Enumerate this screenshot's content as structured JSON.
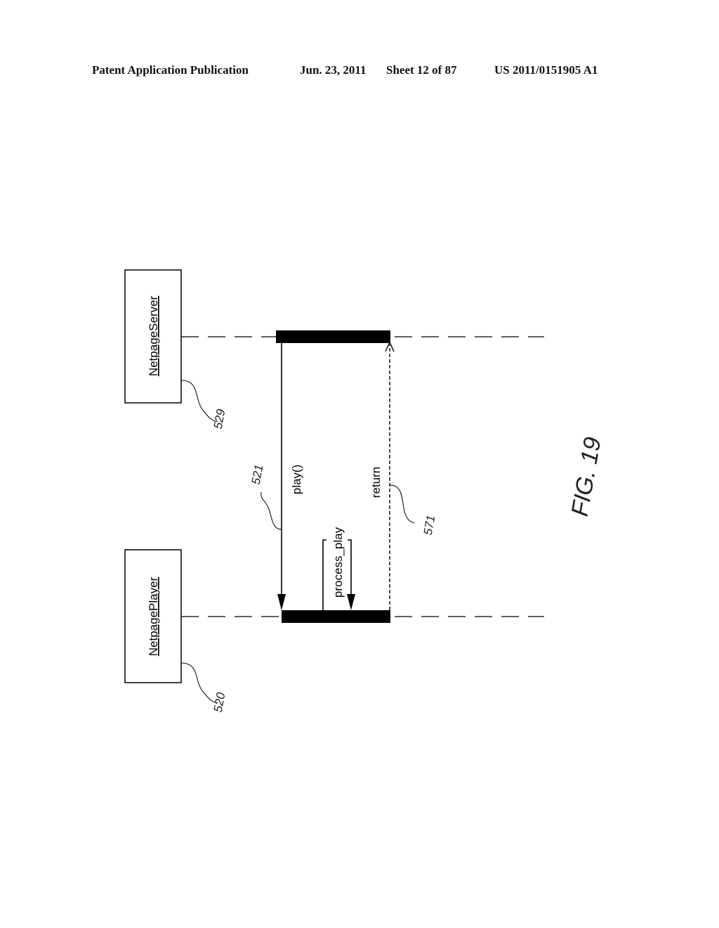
{
  "header": {
    "publication": "Patent Application Publication",
    "date": "Jun. 23, 2011",
    "sheet": "Sheet 12 of 87",
    "number": "US 2011/0151905 A1"
  },
  "figure": {
    "label": "FIG. 19",
    "objects": [
      {
        "name": "NetpageServer",
        "ref": "529"
      },
      {
        "name": "NetpagePlayer",
        "ref": "520"
      }
    ],
    "messages": [
      {
        "label": "play()",
        "ref": "521",
        "from": "NetpageServer",
        "to": "NetpagePlayer",
        "style": "solid"
      },
      {
        "label": "process_play",
        "ref": "",
        "from": "NetpagePlayer",
        "to": "NetpagePlayer",
        "style": "solid"
      },
      {
        "label": "return",
        "ref": "571",
        "from": "NetpagePlayer",
        "to": "NetpageServer",
        "style": "dashed"
      }
    ]
  }
}
